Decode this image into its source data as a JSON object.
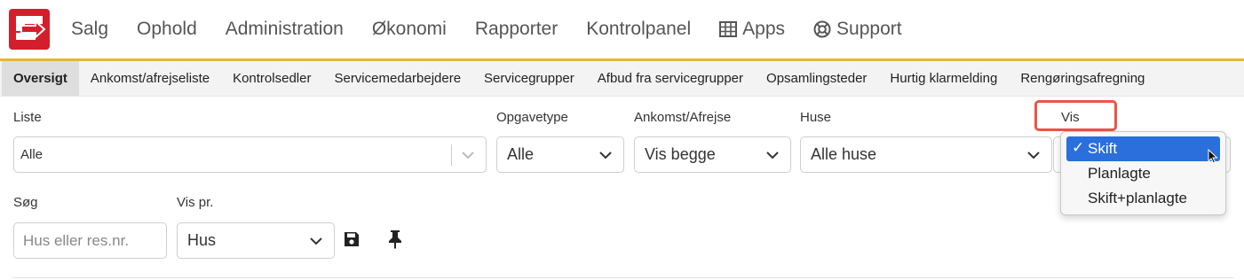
{
  "nav": {
    "items": [
      {
        "label": "Salg"
      },
      {
        "label": "Ophold"
      },
      {
        "label": "Administration"
      },
      {
        "label": "Økonomi"
      },
      {
        "label": "Rapporter"
      },
      {
        "label": "Kontrolpanel"
      },
      {
        "label": "Apps",
        "icon": "grid-icon"
      },
      {
        "label": "Support",
        "icon": "lifebuoy-icon"
      }
    ],
    "accent_color": "#e8b33a",
    "brand_color": "#d21f2b"
  },
  "subnav": {
    "items": [
      {
        "label": "Oversigt",
        "active": true
      },
      {
        "label": "Ankomst/afrejseliste"
      },
      {
        "label": "Kontrolsedler"
      },
      {
        "label": "Servicemedarbejdere"
      },
      {
        "label": "Servicegrupper"
      },
      {
        "label": "Afbud fra servicegrupper"
      },
      {
        "label": "Opsamlingsteder"
      },
      {
        "label": "Hurtig klarmelding"
      },
      {
        "label": "Rengøringsafregning"
      }
    ]
  },
  "filters": {
    "liste": {
      "label": "Liste",
      "value": "Alle"
    },
    "opgavetype": {
      "label": "Opgavetype",
      "value": "Alle"
    },
    "ankomst": {
      "label": "Ankomst/Afrejse",
      "value": "Vis begge"
    },
    "huse": {
      "label": "Huse",
      "value": "Alle huse"
    },
    "vis": {
      "label": "Vis",
      "options": [
        "Skift",
        "Planlagte",
        "Skift+planlagte"
      ],
      "selected": "Skift",
      "check": "✓",
      "highlight_color": "#ea5545"
    },
    "sog": {
      "label": "Søg",
      "placeholder": "Hus eller res.nr."
    },
    "vis_pr": {
      "label": "Vis pr.",
      "value": "Hus"
    }
  },
  "icons": {
    "save": "save-icon",
    "pin": "pin-icon"
  }
}
